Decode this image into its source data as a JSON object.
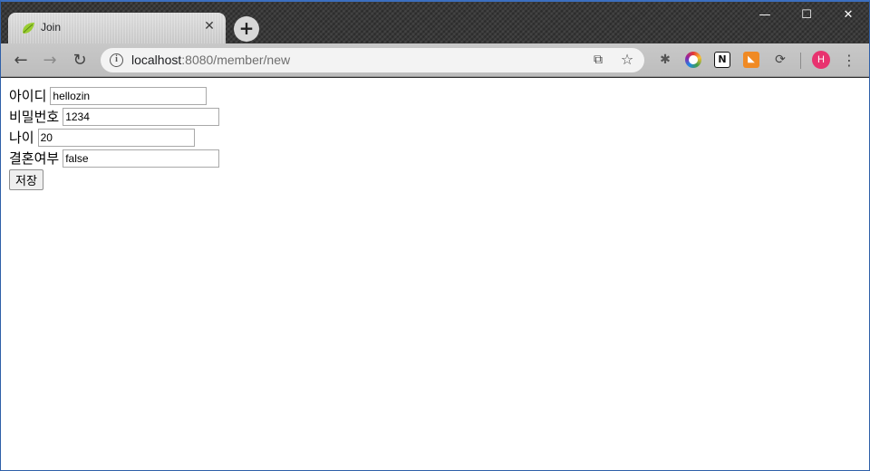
{
  "window": {
    "tab": {
      "title": "Join",
      "close_glyph": "✕"
    },
    "new_tab_glyph": "+",
    "controls": {
      "minimize": "—",
      "maximize": "☐",
      "close": "✕"
    }
  },
  "toolbar": {
    "back_glyph": "←",
    "forward_glyph": "→",
    "reload_glyph": "↻",
    "url_host": "localhost",
    "url_path": ":8080/member/new",
    "translate_glyph": "⧉",
    "star_glyph": "☆",
    "extensions": {
      "bug_glyph": "✱",
      "notion_glyph": "N",
      "rss_glyph": "◣",
      "sync_glyph": "⟳"
    },
    "avatar_initial": "H",
    "menu_glyph": "⋮"
  },
  "form": {
    "id_label": "아이디",
    "id_value": "hellozin",
    "password_label": "비밀번호",
    "password_value": "1234",
    "age_label": "나이",
    "age_value": "20",
    "married_label": "결혼여부",
    "married_value": "false",
    "submit_label": "저장"
  },
  "colors": {
    "accent": "#3c6fbf",
    "avatar": "#e8336f",
    "rss": "#f08a24"
  }
}
